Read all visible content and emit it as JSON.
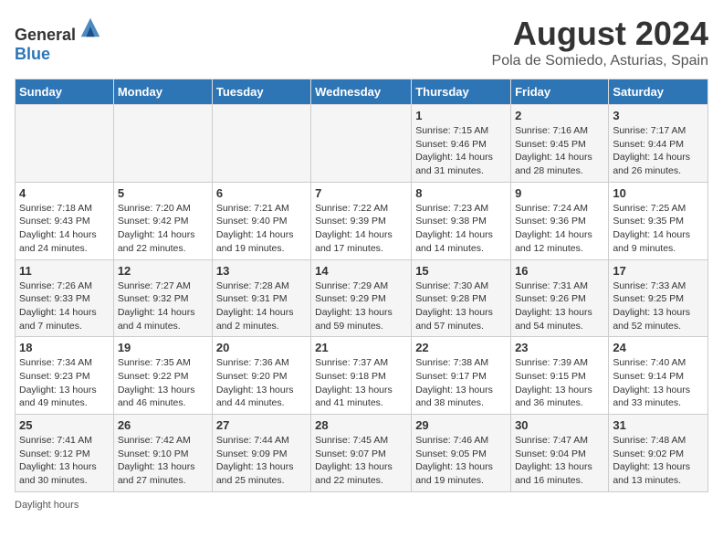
{
  "logo": {
    "text_general": "General",
    "text_blue": "Blue"
  },
  "title": "August 2024",
  "subtitle": "Pola de Somiedo, Asturias, Spain",
  "days_of_week": [
    "Sunday",
    "Monday",
    "Tuesday",
    "Wednesday",
    "Thursday",
    "Friday",
    "Saturday"
  ],
  "weeks": [
    [
      {
        "day": "",
        "sunrise": "",
        "sunset": "",
        "daylight": ""
      },
      {
        "day": "",
        "sunrise": "",
        "sunset": "",
        "daylight": ""
      },
      {
        "day": "",
        "sunrise": "",
        "sunset": "",
        "daylight": ""
      },
      {
        "day": "",
        "sunrise": "",
        "sunset": "",
        "daylight": ""
      },
      {
        "day": "1",
        "sunrise": "Sunrise: 7:15 AM",
        "sunset": "Sunset: 9:46 PM",
        "daylight": "Daylight: 14 hours and 31 minutes."
      },
      {
        "day": "2",
        "sunrise": "Sunrise: 7:16 AM",
        "sunset": "Sunset: 9:45 PM",
        "daylight": "Daylight: 14 hours and 28 minutes."
      },
      {
        "day": "3",
        "sunrise": "Sunrise: 7:17 AM",
        "sunset": "Sunset: 9:44 PM",
        "daylight": "Daylight: 14 hours and 26 minutes."
      }
    ],
    [
      {
        "day": "4",
        "sunrise": "Sunrise: 7:18 AM",
        "sunset": "Sunset: 9:43 PM",
        "daylight": "Daylight: 14 hours and 24 minutes."
      },
      {
        "day": "5",
        "sunrise": "Sunrise: 7:20 AM",
        "sunset": "Sunset: 9:42 PM",
        "daylight": "Daylight: 14 hours and 22 minutes."
      },
      {
        "day": "6",
        "sunrise": "Sunrise: 7:21 AM",
        "sunset": "Sunset: 9:40 PM",
        "daylight": "Daylight: 14 hours and 19 minutes."
      },
      {
        "day": "7",
        "sunrise": "Sunrise: 7:22 AM",
        "sunset": "Sunset: 9:39 PM",
        "daylight": "Daylight: 14 hours and 17 minutes."
      },
      {
        "day": "8",
        "sunrise": "Sunrise: 7:23 AM",
        "sunset": "Sunset: 9:38 PM",
        "daylight": "Daylight: 14 hours and 14 minutes."
      },
      {
        "day": "9",
        "sunrise": "Sunrise: 7:24 AM",
        "sunset": "Sunset: 9:36 PM",
        "daylight": "Daylight: 14 hours and 12 minutes."
      },
      {
        "day": "10",
        "sunrise": "Sunrise: 7:25 AM",
        "sunset": "Sunset: 9:35 PM",
        "daylight": "Daylight: 14 hours and 9 minutes."
      }
    ],
    [
      {
        "day": "11",
        "sunrise": "Sunrise: 7:26 AM",
        "sunset": "Sunset: 9:33 PM",
        "daylight": "Daylight: 14 hours and 7 minutes."
      },
      {
        "day": "12",
        "sunrise": "Sunrise: 7:27 AM",
        "sunset": "Sunset: 9:32 PM",
        "daylight": "Daylight: 14 hours and 4 minutes."
      },
      {
        "day": "13",
        "sunrise": "Sunrise: 7:28 AM",
        "sunset": "Sunset: 9:31 PM",
        "daylight": "Daylight: 14 hours and 2 minutes."
      },
      {
        "day": "14",
        "sunrise": "Sunrise: 7:29 AM",
        "sunset": "Sunset: 9:29 PM",
        "daylight": "Daylight: 13 hours and 59 minutes."
      },
      {
        "day": "15",
        "sunrise": "Sunrise: 7:30 AM",
        "sunset": "Sunset: 9:28 PM",
        "daylight": "Daylight: 13 hours and 57 minutes."
      },
      {
        "day": "16",
        "sunrise": "Sunrise: 7:31 AM",
        "sunset": "Sunset: 9:26 PM",
        "daylight": "Daylight: 13 hours and 54 minutes."
      },
      {
        "day": "17",
        "sunrise": "Sunrise: 7:33 AM",
        "sunset": "Sunset: 9:25 PM",
        "daylight": "Daylight: 13 hours and 52 minutes."
      }
    ],
    [
      {
        "day": "18",
        "sunrise": "Sunrise: 7:34 AM",
        "sunset": "Sunset: 9:23 PM",
        "daylight": "Daylight: 13 hours and 49 minutes."
      },
      {
        "day": "19",
        "sunrise": "Sunrise: 7:35 AM",
        "sunset": "Sunset: 9:22 PM",
        "daylight": "Daylight: 13 hours and 46 minutes."
      },
      {
        "day": "20",
        "sunrise": "Sunrise: 7:36 AM",
        "sunset": "Sunset: 9:20 PM",
        "daylight": "Daylight: 13 hours and 44 minutes."
      },
      {
        "day": "21",
        "sunrise": "Sunrise: 7:37 AM",
        "sunset": "Sunset: 9:18 PM",
        "daylight": "Daylight: 13 hours and 41 minutes."
      },
      {
        "day": "22",
        "sunrise": "Sunrise: 7:38 AM",
        "sunset": "Sunset: 9:17 PM",
        "daylight": "Daylight: 13 hours and 38 minutes."
      },
      {
        "day": "23",
        "sunrise": "Sunrise: 7:39 AM",
        "sunset": "Sunset: 9:15 PM",
        "daylight": "Daylight: 13 hours and 36 minutes."
      },
      {
        "day": "24",
        "sunrise": "Sunrise: 7:40 AM",
        "sunset": "Sunset: 9:14 PM",
        "daylight": "Daylight: 13 hours and 33 minutes."
      }
    ],
    [
      {
        "day": "25",
        "sunrise": "Sunrise: 7:41 AM",
        "sunset": "Sunset: 9:12 PM",
        "daylight": "Daylight: 13 hours and 30 minutes."
      },
      {
        "day": "26",
        "sunrise": "Sunrise: 7:42 AM",
        "sunset": "Sunset: 9:10 PM",
        "daylight": "Daylight: 13 hours and 27 minutes."
      },
      {
        "day": "27",
        "sunrise": "Sunrise: 7:44 AM",
        "sunset": "Sunset: 9:09 PM",
        "daylight": "Daylight: 13 hours and 25 minutes."
      },
      {
        "day": "28",
        "sunrise": "Sunrise: 7:45 AM",
        "sunset": "Sunset: 9:07 PM",
        "daylight": "Daylight: 13 hours and 22 minutes."
      },
      {
        "day": "29",
        "sunrise": "Sunrise: 7:46 AM",
        "sunset": "Sunset: 9:05 PM",
        "daylight": "Daylight: 13 hours and 19 minutes."
      },
      {
        "day": "30",
        "sunrise": "Sunrise: 7:47 AM",
        "sunset": "Sunset: 9:04 PM",
        "daylight": "Daylight: 13 hours and 16 minutes."
      },
      {
        "day": "31",
        "sunrise": "Sunrise: 7:48 AM",
        "sunset": "Sunset: 9:02 PM",
        "daylight": "Daylight: 13 hours and 13 minutes."
      }
    ]
  ],
  "footer": {
    "daylight_label": "Daylight hours"
  }
}
